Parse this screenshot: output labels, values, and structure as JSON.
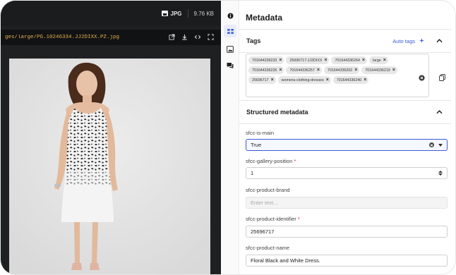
{
  "viewer": {
    "format_label": "JPG",
    "file_size": "9.76 KB",
    "path": "ges/large/PG.10246334.JJ2DIXX.PZ.jpg",
    "tools": [
      "external-link-icon",
      "download-icon",
      "code-icon",
      "expand-icon"
    ]
  },
  "rail": {
    "icons": [
      "info-icon",
      "grid-icon",
      "image-icon",
      "comments-icon"
    ]
  },
  "panel": {
    "title": "Metadata",
    "tags_section": {
      "title": "Tags",
      "auto_tags_label": "Auto tags",
      "tags": [
        "701644336233",
        "25696717-JJ2DIXX",
        "701644336264",
        "large",
        "701644336226",
        "701644336257",
        "701644336202",
        "701644336219",
        "25696717",
        "womens-clothing-dresses",
        "701644336240"
      ]
    },
    "structured": {
      "title": "Structured metadata",
      "fields": [
        {
          "label": "sfcc-is-main",
          "required": "",
          "value": "True",
          "placeholder": ""
        },
        {
          "label": "sfcc-gallery-position",
          "required": "*",
          "value": "1",
          "placeholder": ""
        },
        {
          "label": "sfcc-product-brand",
          "required": "",
          "value": "",
          "placeholder": "Enter text..."
        },
        {
          "label": "sfcc-product-identifier",
          "required": "*",
          "value": "25696717",
          "placeholder": ""
        },
        {
          "label": "sfcc-product-name",
          "required": "",
          "value": "Floral Black and White Dress.",
          "placeholder": ""
        }
      ]
    }
  },
  "colors": {
    "accent": "#3b5bdb",
    "path_text": "#e8b04a",
    "viewer_bg": "#1f2022"
  }
}
